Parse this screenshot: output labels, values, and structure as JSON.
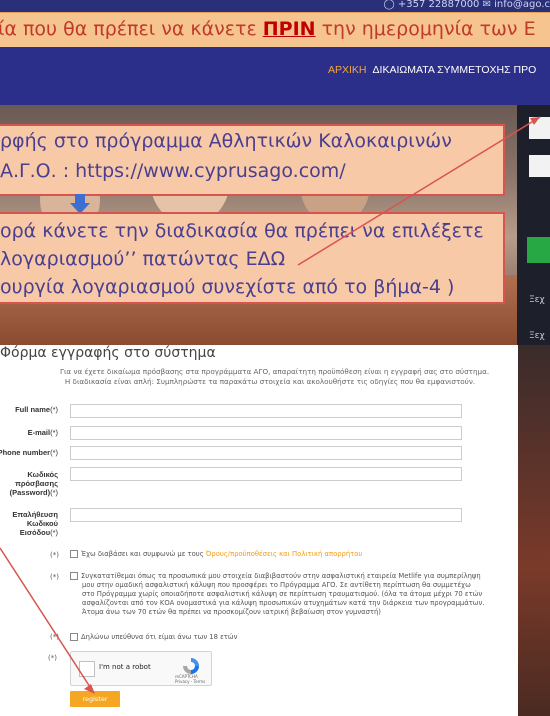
{
  "topbar": {
    "contact": "◯  +357 22887000    ✉  info@ago.c"
  },
  "banner": {
    "prefix": "ία που θα πρέπει να κάνετε ",
    "emphasis": "ΠΡΙΝ",
    "suffix": " την ημερομηνία των Ε"
  },
  "nav": {
    "home": "ΑΡΧΙΚΗ",
    "rights": "ΔΙΚΑΙΩΜΑΤΑ ΣΥΜΜΕΤΟΧΗΣ  ΠΡΟ"
  },
  "callout1": {
    "line1": "ρφής στο πρόγραμμα Αθλητικών Καλοκαιρινών",
    "line2": "Α.Γ.Ο. : https://www.cyprusago.com/"
  },
  "callout2": {
    "line1": "ορά κάνετε την διαδικασία θα πρέπει να επιλέξετε",
    "line2": "λογαριασμού’’ πατώντας ΕΔΩ",
    "line3": "ουργία λογαριασμού συνεχίστε από το βήμα-4 )"
  },
  "side": {
    "item1": "Ξεχ",
    "item2": "Ξεχ"
  },
  "form": {
    "title": "Φόρμα εγγραφής στο σύστημα",
    "intro1": "Για να έχετε δικαίωμα πρόσβασης στα προγράμματα ΑΓΟ, απαραίτητη προϋπόθεση είναι η εγγραφή σας στο σύστημα.",
    "intro2": "Η διαδικασία είναι απλή: Συμπληρώστε τα παρακάτω στοιχεία και ακολουθήστε τις οδηγίες που θα εμφανιστούν.",
    "fields": {
      "full_name": "Full name",
      "email": "E-mail",
      "phone": "Phone number",
      "password": "Κωδικός πρόσβασης (Password)",
      "confirm": "Επαλήθευση Κωδικού Εισόδου"
    },
    "req": "(*)",
    "terms_prefix": "Έχω διαβάσει και συμφωνώ με τους ",
    "terms_link": "Όρους/προϋποθέσεις και Πολιτική απορρήτου",
    "consent_1": "Συγκατατίθεμαι όπως τα προσωπικά μου στοιχεία διαβιβαστούν στην ασφαλιστική εταιρεία Metlife για συμπερίληψη",
    "consent_2": "μου στην ομαδική ασφαλιστική κάλυψη που προσφέρει το Πρόγραμμα ΑΓΟ. Σε αντίθετη περίπτωση θα συμμετέχω",
    "consent_3": "στο Πρόγραμμα χωρίς οποιαδήποτε ασφαλιστική κάλυψη σε περίπτωση τραυματισμού. (όλα τα άτομα μέχρι 70 ετών",
    "consent_4": "ασφαλίζονται από τον ΚΟΑ ονομαστικά για κάλυψη προσωπικών ατυχημάτων κατά την διάρκεια των προγραμμάτων.",
    "consent_5": "Άτομα άνω των 70 ετών θα πρέπει να προσκομίζουν ιατρική βεβαίωση στον γυμναστή)",
    "age": "Δηλώνω υπεύθυνα ότι είμαι άνω των 18 ετών",
    "captcha_text": "I'm not a robot",
    "captcha_brand": "reCAPTCHA",
    "captcha_links": "Privacy - Terms",
    "register": "register"
  }
}
